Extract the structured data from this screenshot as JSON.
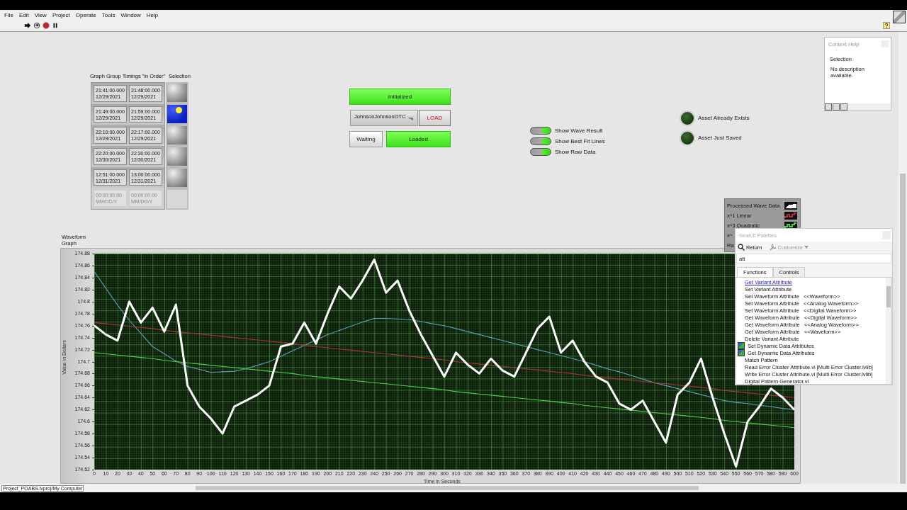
{
  "menu": [
    "File",
    "Edit",
    "View",
    "Project",
    "Operate",
    "Tools",
    "Window",
    "Help"
  ],
  "timings": {
    "label": "Graph Group Timings \"in Order\"",
    "selection_label": "Selection",
    "rows": [
      {
        "start_time": "21:41:00.000",
        "start_date": "12/29/2021",
        "end_time": "21:48:00.000",
        "end_date": "12/29/2021",
        "selected": false,
        "disabled": false
      },
      {
        "start_time": "21:49:00.000",
        "start_date": "12/29/2021",
        "end_time": "21:59:00.000",
        "end_date": "12/29/2021",
        "selected": true,
        "disabled": false
      },
      {
        "start_time": "22:10:00.000",
        "start_date": "12/29/2021",
        "end_time": "22:17:00.000",
        "end_date": "12/29/2021",
        "selected": false,
        "disabled": false
      },
      {
        "start_time": "22:20:00.000",
        "start_date": "12/30/2021",
        "end_time": "22:30:00.000",
        "end_date": "12/30/2021",
        "selected": false,
        "disabled": false
      },
      {
        "start_time": "12:51:00.000",
        "start_date": "12/31/2021",
        "end_time": "13:00:00.000",
        "end_date": "12/31/2021",
        "selected": false,
        "disabled": false
      },
      {
        "start_time": "00:00:00.00",
        "start_date": "MM/DD/Y",
        "end_time": "00:00:00.00",
        "end_date": "MM/DD/Y",
        "selected": false,
        "disabled": true
      }
    ]
  },
  "status_indicator": {
    "text": "Initialized",
    "on": true
  },
  "ticker": {
    "value": "JohnsonJohnsonOTC"
  },
  "load_button": "LOAD",
  "waiting": {
    "text": "Waiting",
    "on": false
  },
  "loaded": {
    "text": "Loaded",
    "on": true
  },
  "switches": [
    {
      "label": "Show Wave Result",
      "on": true
    },
    {
      "label": "Show Best Fit Lines",
      "on": true
    },
    {
      "label": "Show Raw Data",
      "on": true
    }
  ],
  "leds": [
    {
      "label": "Asset Already Exists",
      "on": false
    },
    {
      "label": "Asset Just Saved",
      "on": false
    }
  ],
  "context_help": {
    "title": "Context Help",
    "heading": "Selection",
    "text": "No description available."
  },
  "graph": {
    "label": "Waveform Graph",
    "legend_swatches": [
      {
        "kind": "thick"
      },
      {
        "kind": "thin"
      },
      {
        "kind": "thin"
      },
      {
        "kind": "none"
      }
    ],
    "legend_more": [
      {
        "name": "Ra"
      }
    ],
    "chart_data": {
      "type": "line",
      "xlabel": "Time in Seconds",
      "ylabel": "Value in Dollars",
      "xlim": [
        0,
        600
      ],
      "ylim": [
        174.52,
        174.88
      ],
      "x": [
        0,
        10,
        20,
        30,
        40,
        50,
        60,
        70,
        80,
        90,
        100,
        110,
        120,
        130,
        140,
        150,
        160,
        170,
        180,
        190,
        200,
        210,
        220,
        230,
        240,
        250,
        260,
        270,
        280,
        290,
        300,
        310,
        320,
        330,
        340,
        350,
        360,
        370,
        380,
        390,
        400,
        410,
        420,
        430,
        440,
        450,
        460,
        470,
        480,
        490,
        500,
        510,
        520,
        530,
        540,
        550,
        560,
        570,
        580,
        590,
        600
      ],
      "xticks": [
        0,
        10,
        20,
        30,
        40,
        50,
        60,
        70,
        80,
        90,
        100,
        110,
        120,
        130,
        140,
        150,
        160,
        170,
        180,
        190,
        200,
        210,
        220,
        230,
        240,
        250,
        260,
        270,
        280,
        290,
        300,
        310,
        320,
        330,
        340,
        350,
        360,
        370,
        380,
        390,
        400,
        410,
        420,
        430,
        440,
        450,
        460,
        470,
        480,
        490,
        500,
        510,
        520,
        530,
        540,
        550,
        560,
        570,
        580,
        590,
        600
      ],
      "yticks": [
        174.88,
        174.86,
        174.84,
        174.82,
        174.8,
        174.78,
        174.76,
        174.74,
        174.72,
        174.7,
        174.68,
        174.66,
        174.64,
        174.62,
        174.6,
        174.58,
        174.56,
        174.54,
        174.52
      ],
      "series": [
        {
          "name": "Processed Wave Data",
          "color": "#ffffff",
          "values": [
            174.76,
            174.745,
            174.735,
            174.8,
            174.765,
            174.79,
            174.75,
            174.795,
            174.66,
            174.625,
            174.605,
            174.58,
            174.625,
            174.635,
            174.645,
            174.66,
            174.725,
            174.73,
            174.765,
            174.73,
            174.78,
            174.825,
            174.805,
            174.835,
            174.87,
            174.815,
            174.835,
            174.785,
            174.745,
            174.71,
            174.675,
            174.715,
            174.695,
            174.68,
            174.705,
            174.685,
            174.675,
            174.715,
            174.755,
            174.775,
            174.715,
            174.735,
            174.7,
            174.675,
            174.665,
            174.63,
            174.62,
            174.635,
            174.6,
            174.565,
            174.645,
            174.665,
            174.705,
            174.64,
            174.58,
            174.525,
            174.6,
            174.625,
            174.655,
            174.64,
            174.62
          ]
        },
        {
          "name": "x^1 Linear",
          "color": "#b0303a",
          "values": [
            174.765,
            174.763,
            174.761,
            174.759,
            174.757,
            174.755,
            174.752,
            174.75,
            174.748,
            174.746,
            174.744,
            174.742,
            174.74,
            174.738,
            174.736,
            174.734,
            174.732,
            174.73,
            174.727,
            174.725,
            174.723,
            174.721,
            174.719,
            174.717,
            174.715,
            174.713,
            174.711,
            174.709,
            174.707,
            174.705,
            174.703,
            174.7,
            174.698,
            174.696,
            174.694,
            174.692,
            174.69,
            174.688,
            174.686,
            174.684,
            174.682,
            174.68,
            174.677,
            174.675,
            174.673,
            174.671,
            174.669,
            174.667,
            174.665,
            174.663,
            174.661,
            174.659,
            174.657,
            174.655,
            174.652,
            174.65,
            174.648,
            174.646,
            174.644,
            174.642,
            174.64
          ]
        },
        {
          "name": "x^3 Quadratic",
          "color": "#4ad24a",
          "values": [
            174.715,
            174.713,
            174.711,
            174.709,
            174.707,
            174.705,
            174.702,
            174.7,
            174.698,
            174.696,
            174.694,
            174.692,
            174.69,
            174.688,
            174.686,
            174.684,
            174.682,
            174.68,
            174.677,
            174.675,
            174.673,
            174.671,
            174.669,
            174.667,
            174.665,
            174.663,
            174.661,
            174.659,
            174.657,
            174.655,
            174.653,
            174.65,
            174.648,
            174.646,
            174.644,
            174.642,
            174.64,
            174.638,
            174.636,
            174.634,
            174.632,
            174.63,
            174.627,
            174.625,
            174.623,
            174.621,
            174.619,
            174.617,
            174.615,
            174.613,
            174.611,
            174.609,
            174.607,
            174.605,
            174.602,
            174.6,
            174.598,
            174.596,
            174.594,
            174.592,
            174.59
          ]
        },
        {
          "name": "x^",
          "color": "#5aa0b8",
          "values": [
            174.85,
            174.822,
            174.794,
            174.769,
            174.747,
            174.725,
            174.713,
            174.701,
            174.692,
            174.687,
            174.682,
            174.683,
            174.684,
            174.688,
            174.694,
            174.7,
            174.709,
            174.718,
            174.727,
            174.736,
            174.745,
            174.752,
            174.759,
            174.766,
            174.772,
            174.772,
            174.771,
            174.77,
            174.767,
            174.763,
            174.76,
            174.755,
            174.75,
            174.745,
            174.74,
            174.735,
            174.73,
            174.725,
            174.72,
            174.715,
            174.71,
            174.705,
            174.7,
            174.694,
            174.688,
            174.683,
            174.677,
            174.671,
            174.665,
            174.66,
            174.655,
            174.65,
            174.645,
            174.64,
            174.635,
            174.632,
            174.63,
            174.627,
            174.625,
            174.622,
            174.62
          ]
        }
      ]
    }
  },
  "palette": {
    "title": "Search Palettes",
    "return": "Return",
    "customize": "Customize",
    "search": {
      "value": "att"
    },
    "tabs": [
      {
        "label": "Functions",
        "selected": true
      },
      {
        "label": "Controls",
        "selected": false
      }
    ],
    "items": [
      {
        "label": "Get Variant Attribute",
        "selected": true,
        "icon": false
      },
      {
        "label": "Set Variant Attribute",
        "selected": false,
        "icon": false
      },
      {
        "label": "Set Waveform Attribute   <<Waveform>>",
        "selected": false,
        "icon": false
      },
      {
        "label": "Set Waveform Attribute   <<Analog Waveform>>",
        "selected": false,
        "icon": false
      },
      {
        "label": "Set Waveform Attribute   <<Digital Waveform>>",
        "selected": false,
        "icon": false
      },
      {
        "label": "Get Waveform Attribute   <<Digital Waveform>>",
        "selected": false,
        "icon": false
      },
      {
        "label": "Get Waveform Attribute   <<Analog Waveform>>",
        "selected": false,
        "icon": false
      },
      {
        "label": "Get Waveform Attribute   <<Waveform>>",
        "selected": false,
        "icon": false
      },
      {
        "label": "Delete Variant Attribute",
        "selected": false,
        "icon": false
      },
      {
        "label": "Set Dynamic Data Attributes",
        "selected": false,
        "icon": true
      },
      {
        "label": "Get Dynamic Data Attributes",
        "selected": false,
        "icon": true
      },
      {
        "label": "Match Pattern",
        "selected": false,
        "icon": false
      },
      {
        "label": "Read Error Cluster Attribute.vi [Multi Error Cluster.lvlib]",
        "selected": false,
        "icon": false
      },
      {
        "label": "Write Error Cluster Attribute.vi [Multi Error Cluster.lvlib]",
        "selected": false,
        "icon": false
      },
      {
        "label": "Digital Pattern Generator.vi",
        "selected": false,
        "icon": false
      }
    ]
  },
  "status_bar": {
    "path": "Project_POABS.lvproj/My Computer"
  }
}
